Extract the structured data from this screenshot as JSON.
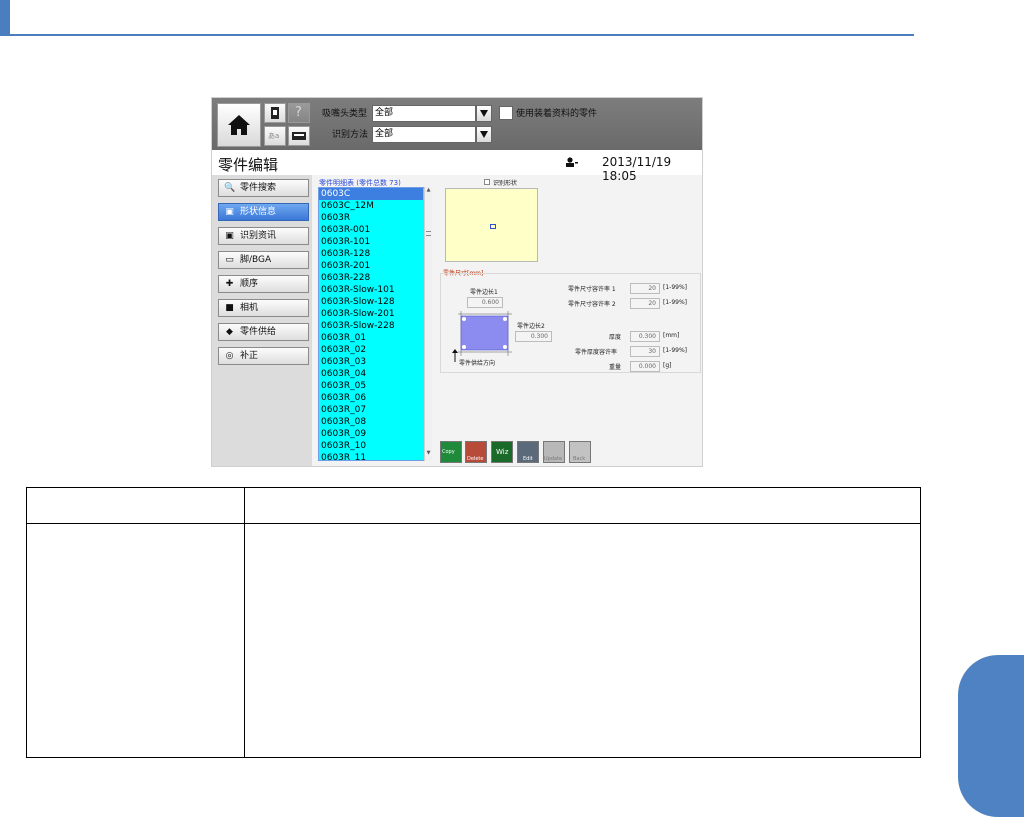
{
  "toolbar": {
    "nozzle_type_label": "吸嘴头类型",
    "nozzle_type_value": "全部",
    "recognition_method_label": "识别方法",
    "recognition_method_value": "全部",
    "use_mounted_parts_label": "使用装着资料的零件"
  },
  "title_bar": {
    "title": "零件编辑",
    "datetime": "2013/11/19 18:05"
  },
  "sidebar": {
    "items": [
      {
        "label": "零件搜索",
        "icon": "search-icon",
        "active": false
      },
      {
        "label": "形状信息",
        "icon": "shape-icon",
        "active": true
      },
      {
        "label": "识别资讯",
        "icon": "recognition-icon",
        "active": false
      },
      {
        "label": "脚/BGA",
        "icon": "pin-icon",
        "active": false
      },
      {
        "label": "顺序",
        "icon": "sequence-icon",
        "active": false
      },
      {
        "label": "相机",
        "icon": "camera-icon",
        "active": false
      },
      {
        "label": "零件供给",
        "icon": "feeder-icon",
        "active": false
      },
      {
        "label": "补正",
        "icon": "correction-icon",
        "active": false
      }
    ]
  },
  "part_list": {
    "header": "零件明细表 (零件总数 73)",
    "items": [
      "0603C",
      "0603C_12M",
      "0603R",
      "0603R-001",
      "0603R-101",
      "0603R-128",
      "0603R-201",
      "0603R-228",
      "0603R-Slow-101",
      "0603R-Slow-128",
      "0603R-Slow-201",
      "0603R-Slow-228",
      "0603R_01",
      "0603R_02",
      "0603R_03",
      "0603R_04",
      "0603R_05",
      "0603R_06",
      "0603R_07",
      "0603R_08",
      "0603R_09",
      "0603R_10",
      "0603R_11"
    ],
    "selected_index": 0
  },
  "shape_panel": {
    "recognize_shape_label": "识别形状",
    "dimensions_header": "零件尺寸[mm]",
    "side_length_1_label": "零件边长1",
    "side_length_1_value": "0.600",
    "side_length_2_label": "零件边长2",
    "side_length_2_value": "0.300",
    "feed_direction_label": "零件供给方向",
    "tolerance_1_label": "零件尺寸容许率 1",
    "tolerance_1_value": "20",
    "tolerance_1_unit": "[1-99%]",
    "tolerance_2_label": "零件尺寸容许率 2",
    "tolerance_2_value": "20",
    "tolerance_2_unit": "[1-99%]",
    "thickness_label": "厚度",
    "thickness_value": "0.300",
    "thickness_unit": "[mm]",
    "thickness_tolerance_label": "零件厚度容许率",
    "thickness_tolerance_value": "30",
    "thickness_tolerance_unit": "[1-99%]",
    "weight_label": "重量",
    "weight_value": "0.000",
    "weight_unit": "[g]"
  },
  "bottom_toolbar": {
    "buttons": [
      "Copy",
      "Delete",
      "Wiz",
      "Edit",
      "Update",
      "Back"
    ]
  },
  "colors": {
    "brand_blue": "#4a7ebf",
    "list_background": "#00ffff",
    "selected_item": "#3c7fe0",
    "preview_background": "#ffffc8"
  }
}
